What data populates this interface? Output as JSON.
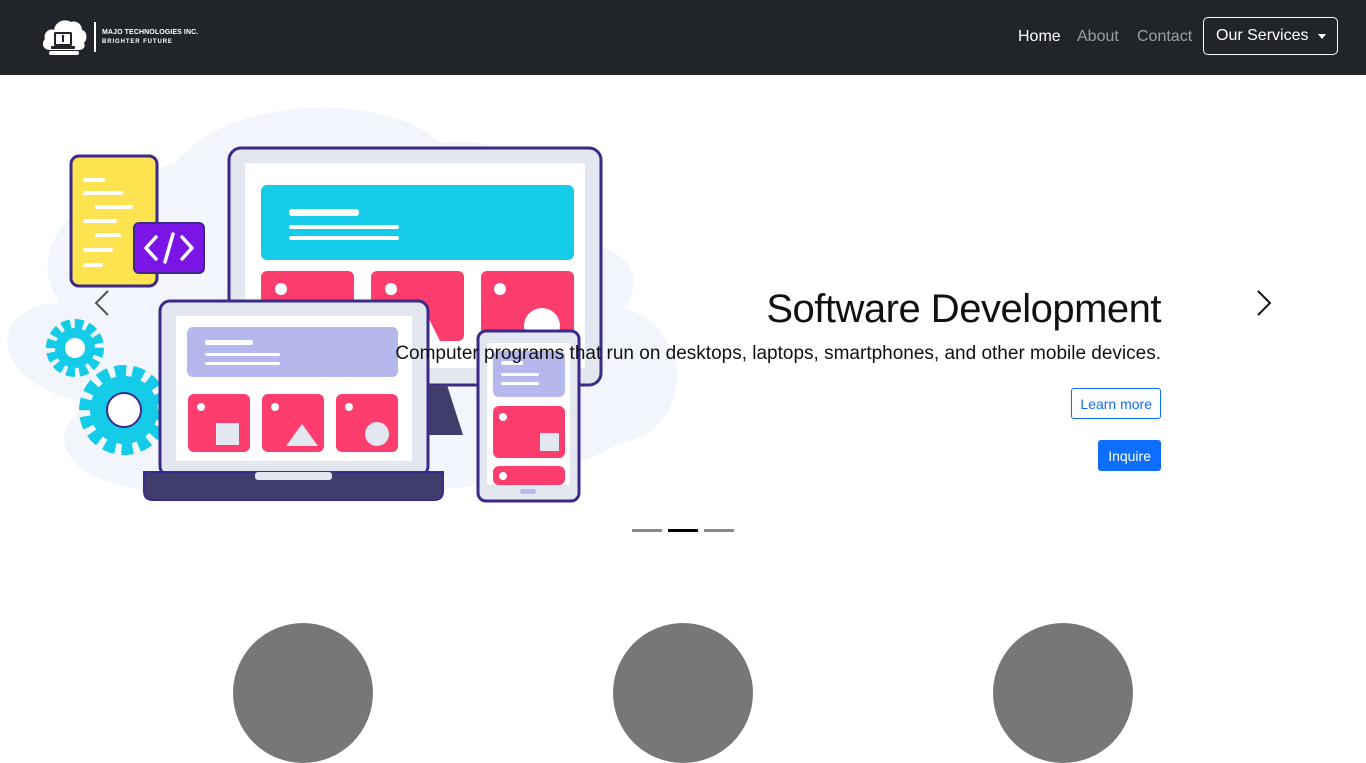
{
  "brand": {
    "name": "MAJO TECHNOLOGIES INC.",
    "tagline": "BRIGHTER FUTURE"
  },
  "nav": {
    "items": [
      {
        "label": "Home",
        "active": true
      },
      {
        "label": "About",
        "active": false
      },
      {
        "label": "Contact",
        "active": false
      }
    ],
    "services_label": "Our Services"
  },
  "carousel": {
    "active_slide": 2,
    "slide_count": 3,
    "title": "Software Development",
    "text": "Computer programs that run on desktops, laptops, smartphones, and other mobile devices.",
    "learn_more_label": "Learn more",
    "inquire_label": "Inquire",
    "prev_icon": "chevron-left-icon",
    "next_icon": "chevron-right-icon"
  },
  "features": {
    "count": 3,
    "placeholder_color": "#777777"
  },
  "colors": {
    "navbar_bg": "#212529",
    "accent": "#0d6efd",
    "pink": "#fc3d6e",
    "cyan": "#15cce8",
    "purple": "#7b15e6"
  }
}
